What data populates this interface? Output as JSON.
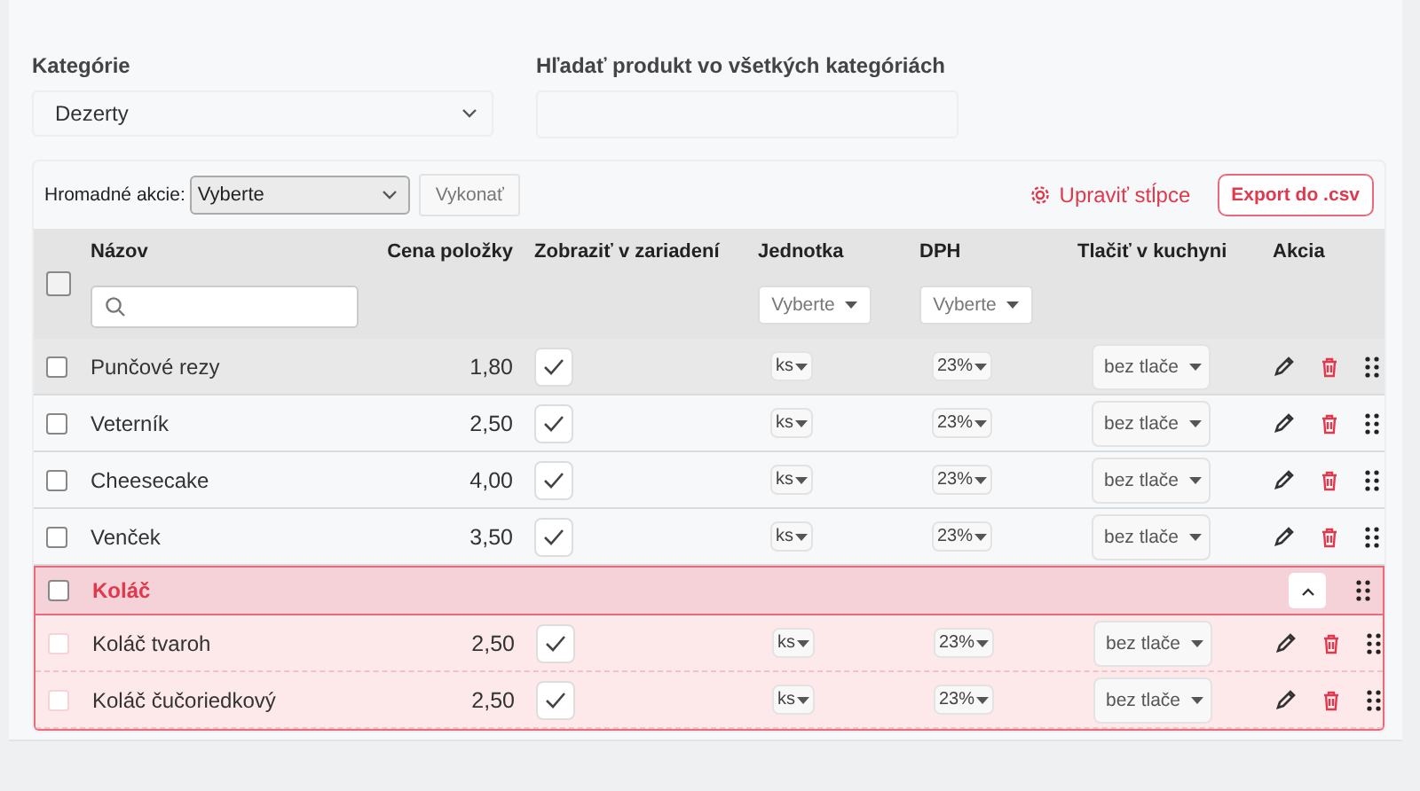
{
  "filters": {
    "category": {
      "label": "Kategórie",
      "value": "Dezerty"
    },
    "search": {
      "label": "Hľadať produkt vo všetkých kategóriách"
    }
  },
  "toolbar": {
    "bulk_label": "Hromadné akcie:",
    "bulk_value": "Vyberte",
    "run_button": "Vykonať",
    "columns_button": "Upraviť stĺpce",
    "export_button": "Export do .csv"
  },
  "table": {
    "columns": [
      "Názov",
      "Cena položky",
      "Zobraziť v zariadení",
      "Jednotka",
      "DPH",
      "Tlačiť v kuchyni",
      "Akcia"
    ],
    "all_checked": false,
    "unit_filter": "Vyberte",
    "vat_filter": "Vyberte",
    "rows": [
      {
        "kind": "item",
        "name": "Punčové rezy",
        "price": "1,80",
        "checked": false,
        "shown": true,
        "unit": "ks",
        "vat": "23%",
        "print": "bez tlače",
        "highlighted": true
      },
      {
        "kind": "item",
        "name": "Veterník",
        "price": "2,50",
        "checked": false,
        "shown": true,
        "unit": "ks",
        "vat": "23%",
        "print": "bez tlače",
        "highlighted": false
      },
      {
        "kind": "item",
        "name": "Cheesecake",
        "price": "4,00",
        "checked": false,
        "shown": true,
        "unit": "ks",
        "vat": "23%",
        "print": "bez tlače",
        "highlighted": false
      },
      {
        "kind": "item",
        "name": "Venček",
        "price": "3,50",
        "checked": false,
        "shown": true,
        "unit": "ks",
        "vat": "23%",
        "print": "bez tlače",
        "highlighted": false
      },
      {
        "kind": "group",
        "name": "Koláč",
        "checked": false,
        "expanded": true,
        "children": [
          {
            "kind": "item",
            "name": "Koláč tvaroh",
            "price": "2,50",
            "checked": false,
            "shown": true,
            "unit": "ks",
            "vat": "23%",
            "print": "bez tlače",
            "highlighted": false
          },
          {
            "kind": "item",
            "name": "Koláč čučoriedkový",
            "price": "2,50",
            "checked": false,
            "shown": true,
            "unit": "ks",
            "vat": "23%",
            "print": "bez tlače",
            "highlighted": false
          }
        ]
      }
    ]
  }
}
